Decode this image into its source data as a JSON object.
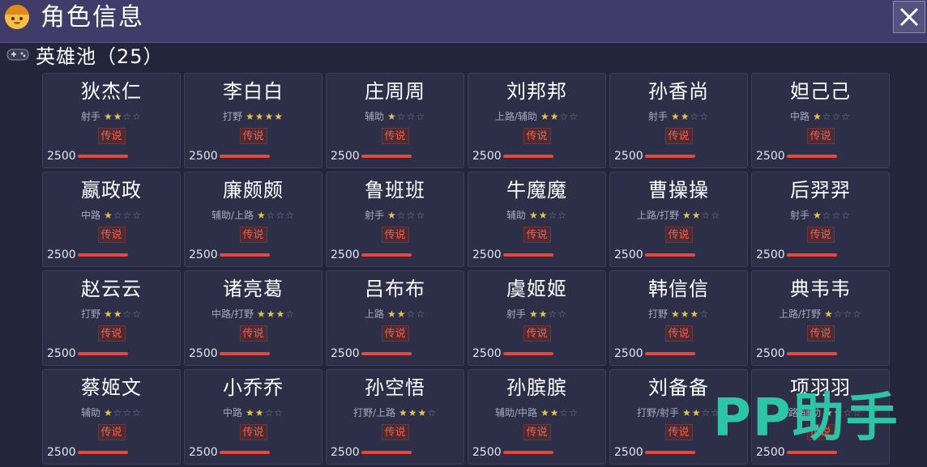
{
  "header": {
    "title": "角色信息"
  },
  "pool": {
    "label": "英雄池（25）"
  },
  "badge_label": "传说",
  "watermark": "PP助手",
  "colors": {
    "title_bar": "#403b68",
    "card_bg": "#2c2f47",
    "badge_text": "#ff5a4a",
    "bar": "#e8483a",
    "star_on": "#e7c24a"
  },
  "heroes": [
    {
      "name": "狄杰仁",
      "role": "射手",
      "stars": 2,
      "power": "2500"
    },
    {
      "name": "李白白",
      "role": "打野",
      "stars": 4,
      "power": "2500"
    },
    {
      "name": "庄周周",
      "role": "辅助",
      "stars": 1,
      "power": "2500"
    },
    {
      "name": "刘邦邦",
      "role": "上路/辅助",
      "stars": 2,
      "power": "2500"
    },
    {
      "name": "孙香尚",
      "role": "射手",
      "stars": 2,
      "power": "2500"
    },
    {
      "name": "妲己己",
      "role": "中路",
      "stars": 1,
      "power": "2500"
    },
    {
      "name": "嬴政政",
      "role": "中路",
      "stars": 1,
      "power": "2500"
    },
    {
      "name": "廉颇颇",
      "role": "辅助/上路",
      "stars": 1,
      "power": "2500"
    },
    {
      "name": "鲁班班",
      "role": "射手",
      "stars": 1,
      "power": "2500"
    },
    {
      "name": "牛魔魔",
      "role": "辅助",
      "stars": 2,
      "power": "2500"
    },
    {
      "name": "曹操操",
      "role": "上路/打野",
      "stars": 2,
      "power": "2500"
    },
    {
      "name": "后羿羿",
      "role": "射手",
      "stars": 1,
      "power": "2500"
    },
    {
      "name": "赵云云",
      "role": "打野",
      "stars": 2,
      "power": "2500"
    },
    {
      "name": "诸亮葛",
      "role": "中路/打野",
      "stars": 3,
      "power": "2500"
    },
    {
      "name": "吕布布",
      "role": "上路",
      "stars": 2,
      "power": "2500"
    },
    {
      "name": "虞姬姬",
      "role": "射手",
      "stars": 2,
      "power": "2500"
    },
    {
      "name": "韩信信",
      "role": "打野",
      "stars": 3,
      "power": "2500"
    },
    {
      "name": "典韦韦",
      "role": "上路/打野",
      "stars": 1,
      "power": "2500"
    },
    {
      "name": "蔡姬文",
      "role": "辅助",
      "stars": 1,
      "power": "2500"
    },
    {
      "name": "小乔乔",
      "role": "中路",
      "stars": 2,
      "power": "2500"
    },
    {
      "name": "孙空悟",
      "role": "打野/上路",
      "stars": 3,
      "power": "2500"
    },
    {
      "name": "孙膑膑",
      "role": "辅助/中路",
      "stars": 2,
      "power": "2500"
    },
    {
      "name": "刘备备",
      "role": "打野/射手",
      "stars": 2,
      "power": "2500"
    },
    {
      "name": "项羽羽",
      "role": "上路/辅助",
      "stars": 2,
      "power": "2500"
    }
  ]
}
